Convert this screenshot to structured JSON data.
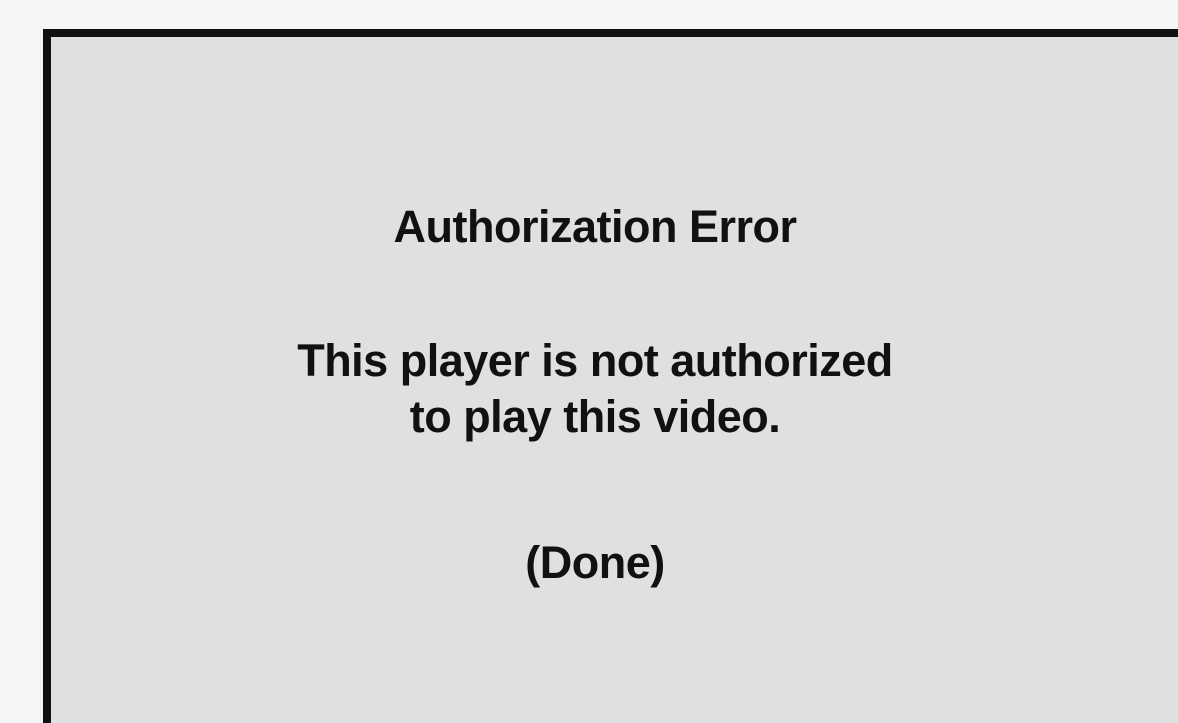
{
  "dialog": {
    "title": "Authorization Error",
    "message_line1": "This player is not authorized",
    "message_line2": "to play this video.",
    "done_label": "(Done)"
  },
  "colors": {
    "background": "#e0e0e0",
    "border": "#111111",
    "text": "#111111"
  }
}
